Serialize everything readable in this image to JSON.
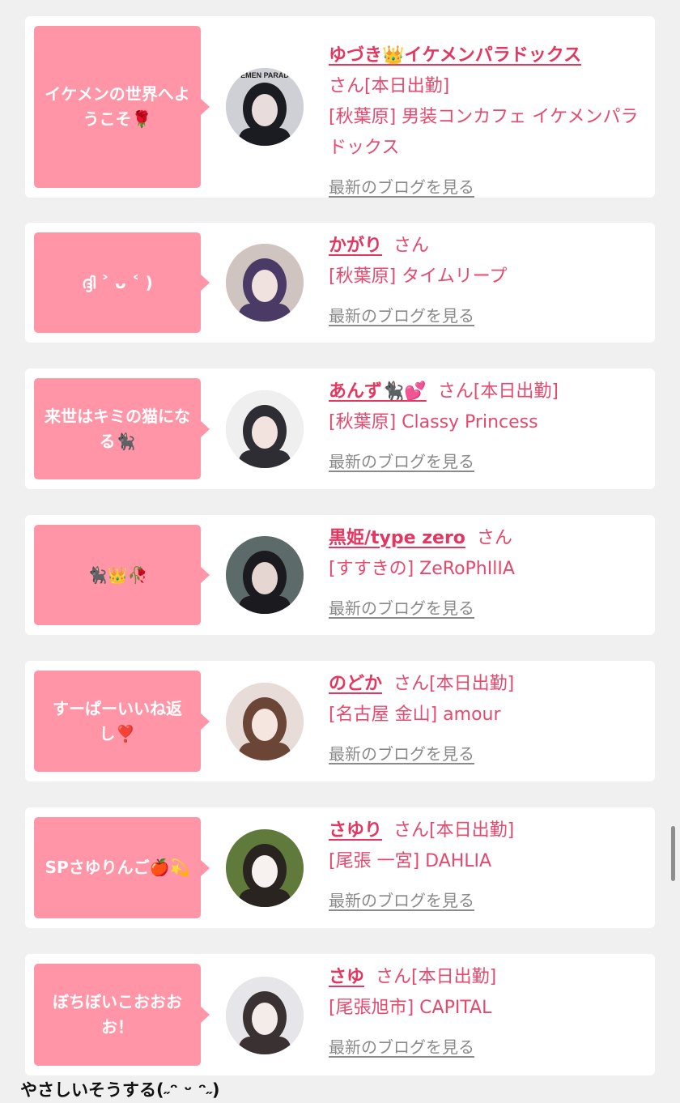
{
  "blog_link_label": "最新のブログを見る",
  "entries": [
    {
      "bubble": "イケメンの世界へようこそ🌹",
      "name": "ゆづき👑イケメンパラドックス",
      "suffix": "さん[本日出勤]",
      "shop": "[秋葉原] 男装コンカフェ イケメンパラドックス",
      "avatar_text": "EMEN PARAD",
      "avatar_colors": [
        "#cfcfd6",
        "#1b1b22",
        "#e9dcdc"
      ]
    },
    {
      "bubble": "ദ്ദി ˃ ᴗ ˂ )",
      "name": "かがり",
      "suffix": "さん",
      "shop": "[秋葉原] タイムリープ",
      "avatar_colors": [
        "#cfc4c0",
        "#4a3a66",
        "#efe2df"
      ]
    },
    {
      "bubble": "来世はキミの猫になる🐈‍⬛",
      "name": "あんず🐈‍⬛💕",
      "suffix": "さん[本日出勤]",
      "shop": "[秋葉原] Classy Princess",
      "avatar_colors": [
        "#efefef",
        "#2d2d33",
        "#f3e3df"
      ]
    },
    {
      "bubble": "🐈‍⬛👑🥀",
      "name": "黒姫/type zero",
      "suffix": "さん",
      "shop": "[すすきの] ZeRoPhIlIA",
      "avatar_colors": [
        "#5c6a6a",
        "#1a1a1f",
        "#e6d6d2"
      ]
    },
    {
      "bubble": "すーぱーいいね返し❣️",
      "name": "のどか",
      "suffix": "さん[本日出勤]",
      "shop": "[名古屋 金山] amour",
      "avatar_colors": [
        "#e8dcd8",
        "#6b4636",
        "#f5e6e0"
      ]
    },
    {
      "bubble": "SPさゆりんご🍎💫",
      "name": "さゆり",
      "suffix": "さん[本日出勤]",
      "shop": "[尾張 一宮] DAHLIA",
      "avatar_colors": [
        "#5f7a3a",
        "#2a2420",
        "#f7f2f0"
      ]
    },
    {
      "bubble": "ぼちぼいこおおおお！",
      "name": "さゆ",
      "suffix": "さん[本日出勤]",
      "shop": "[尾張旭市] CAPITAL",
      "avatar_colors": [
        "#e6e6ea",
        "#3a3232",
        "#f4ece8"
      ]
    }
  ],
  "footer_text": "やさしいそうする(˶ᵔ ᵕ ᵔ˶)",
  "colors": {
    "page_bg": "#f0f0f0",
    "card_bg": "#ffffff",
    "bubble_bg": "#ff95a6",
    "name_color": "#e5365f",
    "shop_color": "#e5496e",
    "link_color": "#8a8a8a"
  }
}
